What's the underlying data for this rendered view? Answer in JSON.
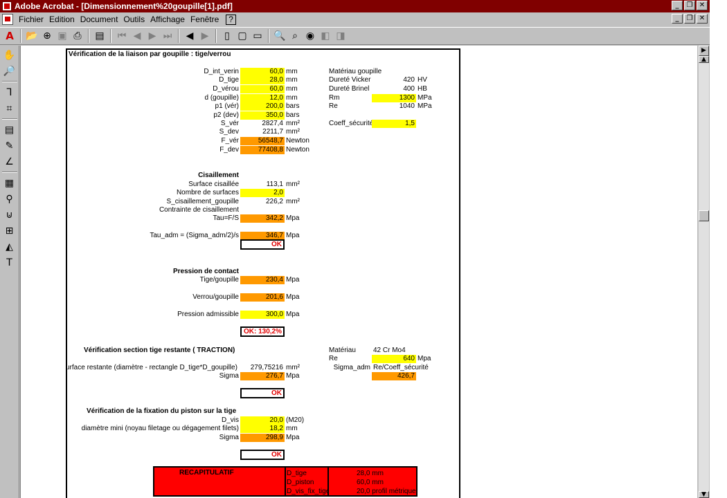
{
  "window": {
    "title": "Adobe Acrobat - [Dimensionnement%20goupille[1].pdf]",
    "buttons": [
      "_",
      "❐",
      "✕"
    ]
  },
  "menu": [
    "Fichier",
    "Edition",
    "Document",
    "Outils",
    "Affichage",
    "Fenêtre",
    "?"
  ],
  "doc": {
    "heading": "Vérification de la liaison par goupille : tige/verrou",
    "inputs_left": [
      {
        "label": "D_int_verin",
        "value": "60,0",
        "unit": "mm",
        "color": "#ffff00"
      },
      {
        "label": "D_tige",
        "value": "28,0",
        "unit": "mm",
        "color": "#ffff00"
      },
      {
        "label": "D_vérou",
        "value": "60,0",
        "unit": "mm",
        "color": "#ffff00"
      },
      {
        "label": "d (goupille)",
        "value": "12,0",
        "unit": "mm",
        "color": "#ffff00"
      },
      {
        "label": "p1 (vér)",
        "value": "200,0",
        "unit": "bars",
        "color": "#ffff00"
      },
      {
        "label": "p2 (dev)",
        "value": "350,0",
        "unit": "bars",
        "color": "#ffff00"
      },
      {
        "label": "S_vér",
        "value": "2827,4",
        "unit": "mm²",
        "color": ""
      },
      {
        "label": "S_dev",
        "value": "2211,7",
        "unit": "mm²",
        "color": ""
      },
      {
        "label": "F_vér",
        "value": "56548,7",
        "unit": "Newton",
        "color": "#ff9900"
      },
      {
        "label": "F_dev",
        "value": "77408,8",
        "unit": "Newton",
        "color": "#ff9900"
      }
    ],
    "material": {
      "title": "Matériau goupille",
      "rows": [
        {
          "label": "Dureté Vicker",
          "value": "420",
          "unit": "HV",
          "color": ""
        },
        {
          "label": "Dureté Brinel",
          "value": "400",
          "unit": "HB",
          "color": ""
        },
        {
          "label": "Rm",
          "value": "1300",
          "unit": "MPa",
          "color": "#ffff00"
        },
        {
          "label": "Re",
          "value": "1040",
          "unit": "MPa",
          "color": ""
        }
      ],
      "coeff_label": "Coeff_sécurité",
      "coeff_value": "1,5"
    },
    "cisaillement": {
      "title": "Cisaillement",
      "surface_label": "Surface cisaillée",
      "surface_value": "113,1",
      "surface_unit": "mm²",
      "nb_label": "Nombre de surfaces",
      "nb_value": "2,0",
      "scis_label": "S_cisaillement_goupille",
      "scis_value": "226,2",
      "scis_unit": "mm²",
      "contrainte_label": "Contrainte de cisaillement",
      "tau_label": "Tau=F/S",
      "tau_value": "342,2",
      "tau_unit": "Mpa",
      "tauadm_label": "Tau_adm = (Sigma_adm/2)/s",
      "tauadm_value": "346,7",
      "tauadm_unit": "Mpa",
      "ok": "OK"
    },
    "pression": {
      "title": "Pression de contact",
      "tige_label": "Tige/goupille",
      "tige_value": "230,4",
      "tige_unit": "Mpa",
      "verrou_label": "Verrou/goupille",
      "verrou_value": "201,6",
      "verrou_unit": "Mpa",
      "adm_label": "Pression admissible",
      "adm_value": "300,0",
      "adm_unit": "Mpa",
      "ok": "OK: 130,2%"
    },
    "traction": {
      "title": "Vérification section tige restante ( TRACTION)",
      "surface_label": "urface restante (diamètre - rectangle D_tige*D_goupille)",
      "surface_value": "279,75216",
      "surface_unit": "mm²",
      "sigma_label": "Sigma",
      "sigma_value": "276,7",
      "sigma_unit": "Mpa",
      "materiau_label": "Matériau",
      "materiau_value": "42 Cr Mo4",
      "re_label": "Re",
      "re_value": "640",
      "re_unit": "Mpa",
      "sigadm_label": "Sigma_adm",
      "sigadm_formula": "Re/Coeff_sécurité",
      "sigadm_value": "426,7",
      "ok": "OK"
    },
    "fixation": {
      "title": "Vérification de la fixation du piston sur la tige",
      "dvis_label": "D_vis",
      "dvis_value": "20,0",
      "dvis_unit": "(M20)",
      "dmin_label": "diamètre mini (noyau filetage ou dégagement filets)",
      "dmin_value": "18,2",
      "dmin_unit": "mm",
      "sigma_label": "Sigma",
      "sigma_value": "298,9",
      "sigma_unit": "Mpa",
      "ok": "OK"
    },
    "recap": {
      "title": "RECAPITULATIF",
      "rows": [
        {
          "label": "D_tige",
          "value": "28,0 mm"
        },
        {
          "label": "D_piston",
          "value": "60,0 mm"
        },
        {
          "label": "D_vis_fix_tige",
          "value": "20,0 profil métrique"
        }
      ]
    }
  }
}
